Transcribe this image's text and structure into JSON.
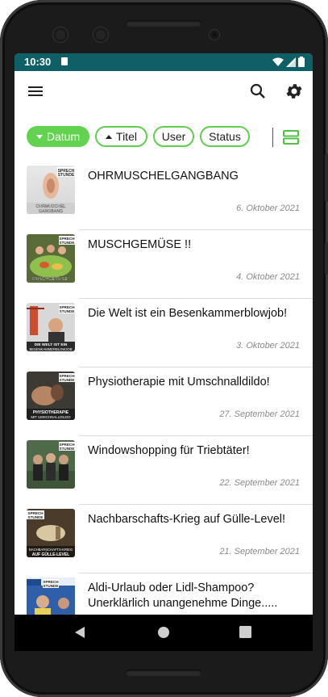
{
  "status_bar": {
    "time": "10:30"
  },
  "app_bar": {
    "menu_icon": "hamburger-menu-icon",
    "search_icon": "search-icon",
    "settings_icon": "gear-icon"
  },
  "sort_chips": [
    {
      "label": "Datum",
      "active": true,
      "arrow": "down"
    },
    {
      "label": "Titel",
      "active": false,
      "arrow": "up"
    },
    {
      "label": "User",
      "active": false
    },
    {
      "label": "Status",
      "active": false
    }
  ],
  "view_toggle_icon": "list-view-icon",
  "accent_color": "#63d251",
  "status_bar_color": "#0f5f66",
  "episodes": [
    {
      "title": "OHRMUSCHELGANGBANG",
      "date": "6. Oktober 2021",
      "thumb_caption": "OHRMUSCHELGANGBANG",
      "thumb_header": "SPRECH STUNDE"
    },
    {
      "title": "MUSCHGEMÜSE !!",
      "date": "4. Oktober 2021",
      "thumb_caption": "MUSCHGEMÜSE!",
      "thumb_header": "SPRECH STUNDE"
    },
    {
      "title": "Die Welt ist ein Besenkammerblowjob!",
      "date": "3. Oktober 2021",
      "thumb_caption": "DIE WELT IST EIN BESENKAMMERBLOWJOB",
      "thumb_header": "SPRECH STUNDE"
    },
    {
      "title": "Physiotherapie mit Umschnalldildo!",
      "date": "27. September 2021",
      "thumb_caption": "PHYSIOTHERAPIE MIT UMSCHNALLDILDO",
      "thumb_header": "SPRECH STUNDE"
    },
    {
      "title": "Windowshopping für Triebtäter!",
      "date": "22. September 2021",
      "thumb_caption": "",
      "thumb_header": "SPRECH STUNDE"
    },
    {
      "title": "Nachbarschafts-Krieg auf Gülle-Level!",
      "date": "21. September 2021",
      "thumb_caption": "NACHBARSCHAFTS-KRIEG AUF GÜLLE-LEVEL",
      "thumb_header": "SPRECH STUNDE"
    },
    {
      "title": "Aldi-Urlaub oder Lidl-Shampoo? Unerklärlich unangenehme Dinge.....",
      "date": "",
      "thumb_caption": "",
      "thumb_header": "SPRECH STUNDE"
    }
  ]
}
